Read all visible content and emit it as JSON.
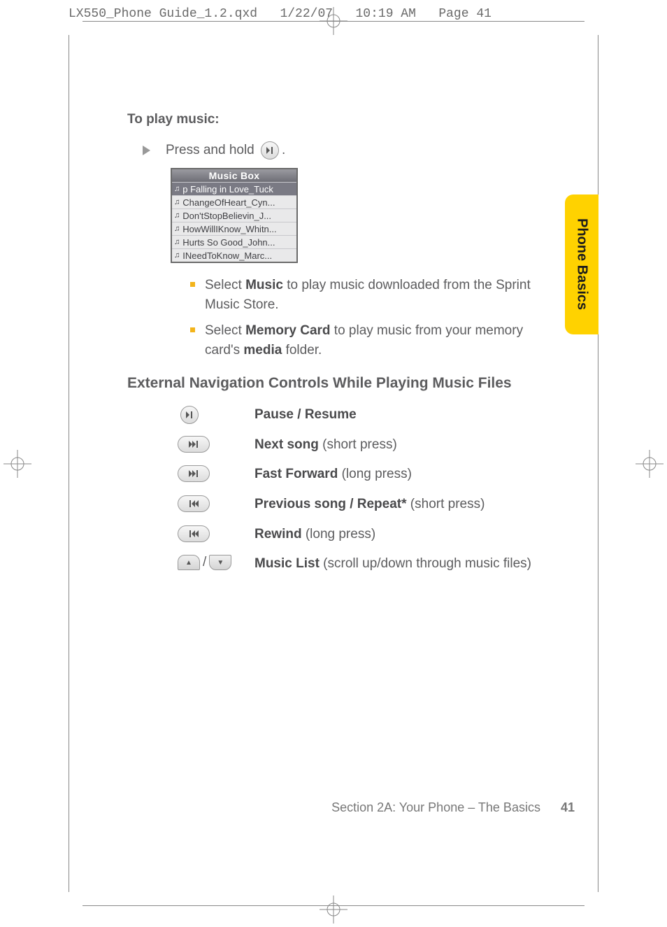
{
  "header": {
    "filename": "LX550_Phone Guide_1.2.qxd",
    "date": "1/22/07",
    "time": "10:19 AM",
    "page_label": "Page 41"
  },
  "side_tab": "Phone Basics",
  "section": {
    "to_play": "To play music:",
    "press_hold": "Press and hold",
    "period": ".",
    "musicbox": {
      "title": "Music Box",
      "items": [
        "p Falling in Love_Tuck",
        "ChangeOfHeart_Cyn...",
        "Don'tStopBelievin_J...",
        "HowWillIKnow_Whitn...",
        "Hurts So Good_John...",
        "INeedToKnow_Marc..."
      ]
    },
    "bullets": {
      "music_pre": "Select ",
      "music_bold": "Music",
      "music_post": " to play music downloaded from the Sprint Music Store.",
      "mem_pre": "Select ",
      "mem_bold": "Memory Card",
      "mem_post_a": " to play music from your memory card's ",
      "mem_bold2": "media",
      "mem_post_b": " folder."
    },
    "controls_heading": "External Navigation Controls While Playing Music Files",
    "controls": {
      "pause": {
        "label": "Pause / Resume"
      },
      "next": {
        "label": "Next song",
        "note": " (short press)"
      },
      "ff": {
        "label": "Fast Forward",
        "note": " (long press)"
      },
      "prev": {
        "label": "Previous song / Repeat*",
        "note": " (short press)"
      },
      "rew": {
        "label": "Rewind",
        "note": " (long press)"
      },
      "list": {
        "label": "Music List",
        "note": " (scroll up/down through music files)"
      }
    }
  },
  "footer": {
    "section": "Section 2A: Your Phone – The Basics",
    "page": "41"
  }
}
